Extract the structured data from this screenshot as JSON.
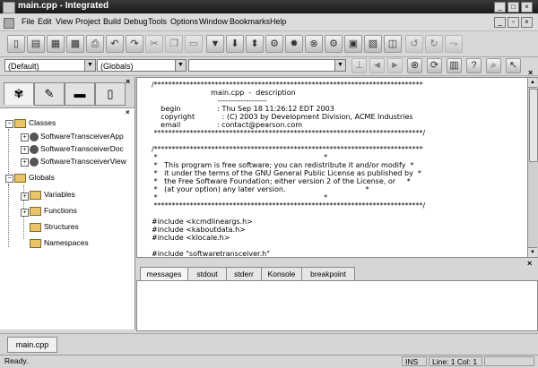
{
  "window": {
    "title": "main.cpp - Integrated",
    "controls": [
      "_",
      "□",
      "×"
    ]
  },
  "menu": {
    "items": [
      "File",
      "Edit",
      "View",
      "Project",
      "Build",
      "Debug",
      "Tools",
      "Options",
      "Window",
      "Bookmarks",
      "Help"
    ]
  },
  "combos": {
    "scope": "(Default)",
    "globals": "(Globals)",
    "third": ""
  },
  "classview": {
    "classes_label": "Classes",
    "class_items": [
      "SoftwareTransceiverApp",
      "SoftwareTransceiverDoc",
      "SoftwareTransceiverView"
    ],
    "globals_label": "Globals",
    "global_items": [
      "Variables",
      "Functions",
      "Structures",
      "Namespaces"
    ]
  },
  "editor": {
    "lines": [
      "/***************************************************************************",
      "                          main.cpp  -  description",
      "                             -------------------",
      "    begin                : Thu Sep 18 11:26:12 EDT 2003",
      "    copyright            : (C) 2003 by Development Division, ACME Industries",
      "    email                : contact@pearson.com",
      " ***************************************************************************/",
      "",
      "/***************************************************************************",
      " *                                                                         *",
      " *   This program is free software; you can redistribute it and/or modify  *",
      " *   it under the terms of the GNU General Public License as published by  *",
      " *   the Free Software Foundation; either version 2 of the License, or     *",
      " *   (at your option) any later version.                                   *",
      " *                                                                         *",
      " ***************************************************************************/",
      "",
      "#include <kcmdlineargs.h>",
      "#include <kaboutdata.h>",
      "#include <klocale.h>",
      "",
      "#include \"softwaretransceiver.h\""
    ]
  },
  "output_tabs": [
    "messages",
    "stdout",
    "stderr",
    "Konsole",
    "breakpoint"
  ],
  "file_tabs": [
    "main.cpp"
  ],
  "status": {
    "text": "Ready.",
    "mode": "INS",
    "position": "Line: 1 Col: 1"
  }
}
